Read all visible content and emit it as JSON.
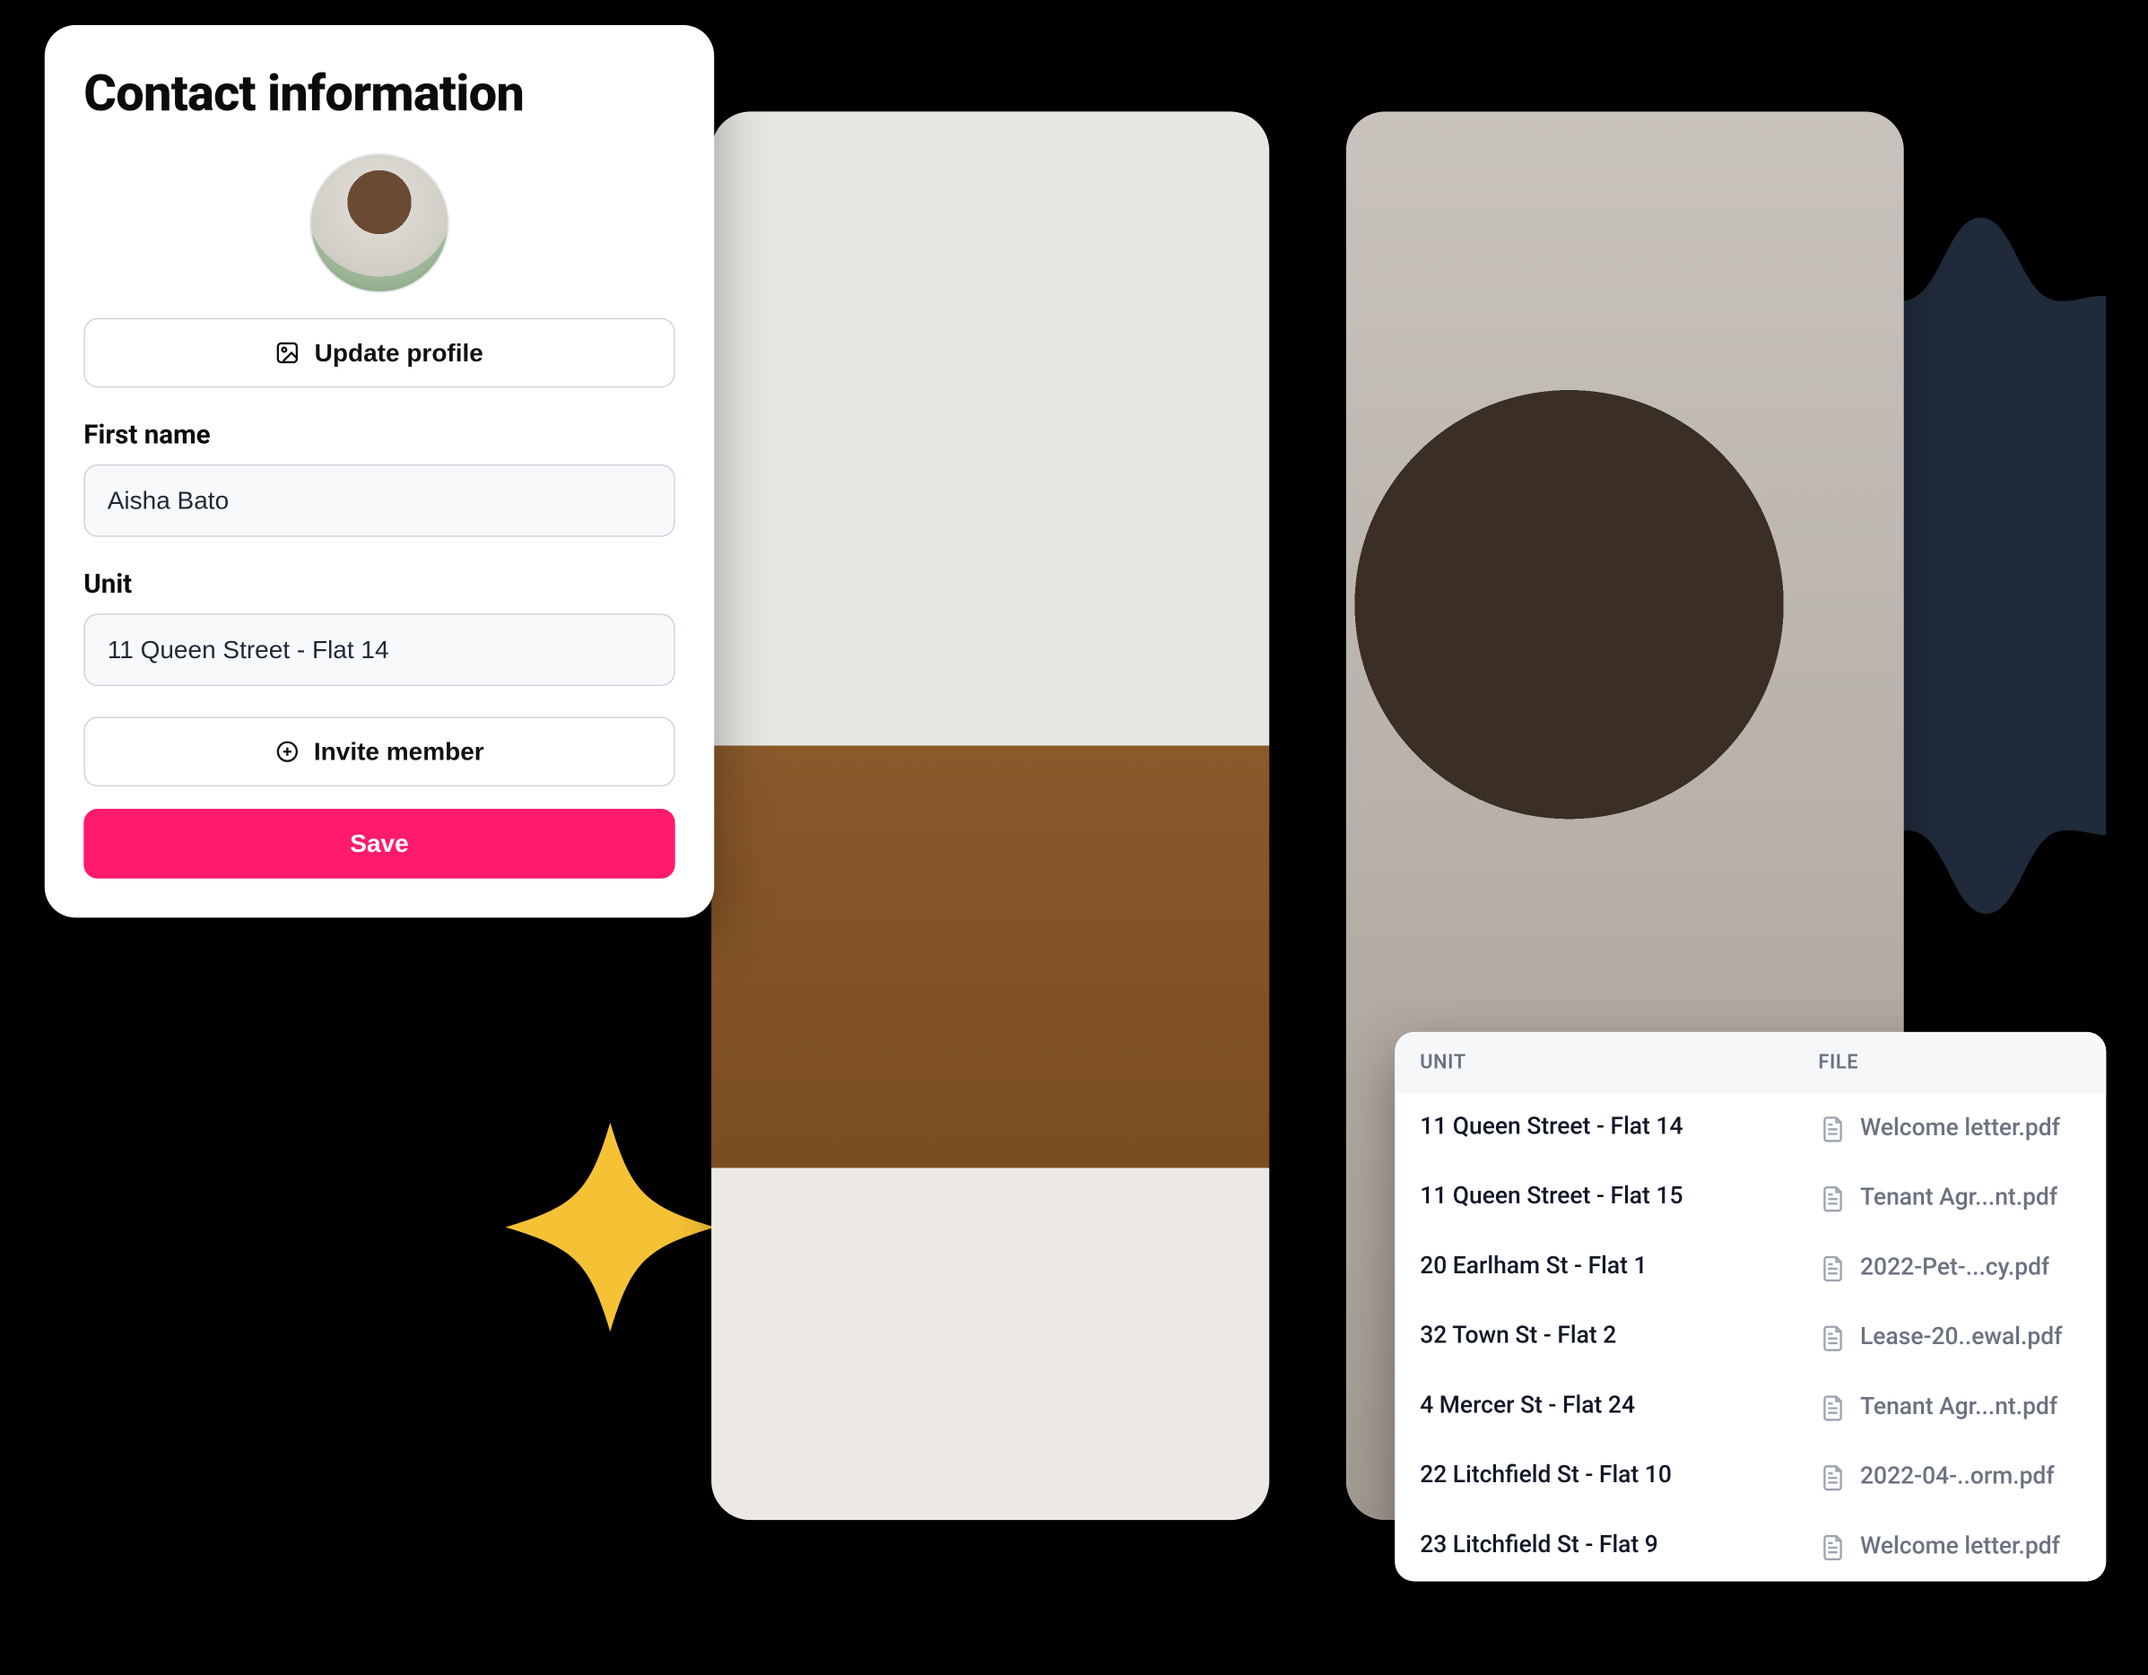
{
  "contact": {
    "title": "Contact information",
    "updateProfile": "Update profile",
    "labels": {
      "firstName": "First name",
      "unit": "Unit"
    },
    "values": {
      "firstName": "Aisha Bato",
      "unit": "11 Queen Street - Flat 14"
    },
    "inviteMember": "Invite member",
    "save": "Save"
  },
  "filesTable": {
    "headers": {
      "unit": "UNIT",
      "file": "FILE"
    },
    "rows": [
      {
        "unit": "11 Queen Street - Flat 14",
        "file": "Welcome letter.pdf"
      },
      {
        "unit": "11 Queen Street - Flat 15",
        "file": "Tenant Agr...nt.pdf"
      },
      {
        "unit": "20 Earlham St - Flat 1",
        "file": "2022-Pet-...cy.pdf"
      },
      {
        "unit": "32 Town St - Flat 2",
        "file": "Lease-20..ewal.pdf"
      },
      {
        "unit": "4 Mercer St - Flat 24",
        "file": "Tenant Agr...nt.pdf"
      },
      {
        "unit": "22 Litchfield St - Flat 10",
        "file": "2022-04-..orm.pdf"
      },
      {
        "unit": "23 Litchfield St - Flat 9",
        "file": "Welcome letter.pdf"
      }
    ]
  },
  "colors": {
    "accent": "#ff1a6c",
    "navyBlob": "#1f2a3a",
    "yellowBlob": "#f5c236"
  }
}
